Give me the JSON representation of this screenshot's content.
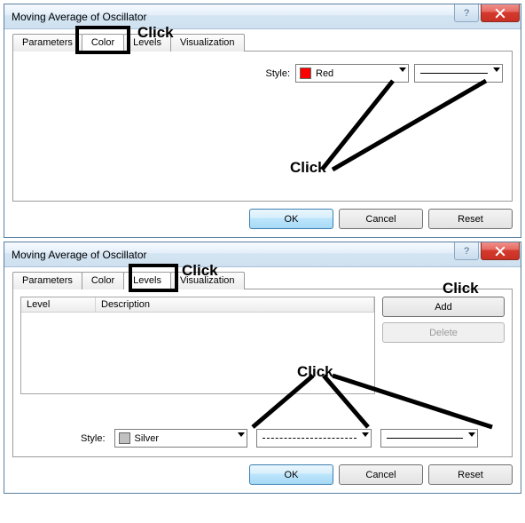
{
  "dialog1": {
    "title": "Moving Average of Oscillator",
    "tabs": {
      "parameters": "Parameters",
      "color": "Color",
      "levels": "Levels",
      "visualization": "Visualization"
    },
    "style_label": "Style:",
    "color_name": "Red",
    "color_hex": "#ff0000",
    "buttons": {
      "ok": "OK",
      "cancel": "Cancel",
      "reset": "Reset"
    },
    "anno_tab": "Click",
    "anno_combo": "Click"
  },
  "dialog2": {
    "title": "Moving Average of Oscillator",
    "tabs": {
      "parameters": "Parameters",
      "color": "Color",
      "levels": "Levels",
      "visualization": "Visualization"
    },
    "grid": {
      "level": "Level",
      "description": "Description"
    },
    "side": {
      "add": "Add",
      "delete": "Delete"
    },
    "style_label": "Style:",
    "color_name": "Silver",
    "color_hex": "#c0c0c0",
    "buttons": {
      "ok": "OK",
      "cancel": "Cancel",
      "reset": "Reset"
    },
    "anno_tab": "Click",
    "anno_add": "Click",
    "anno_combo": "Click"
  }
}
